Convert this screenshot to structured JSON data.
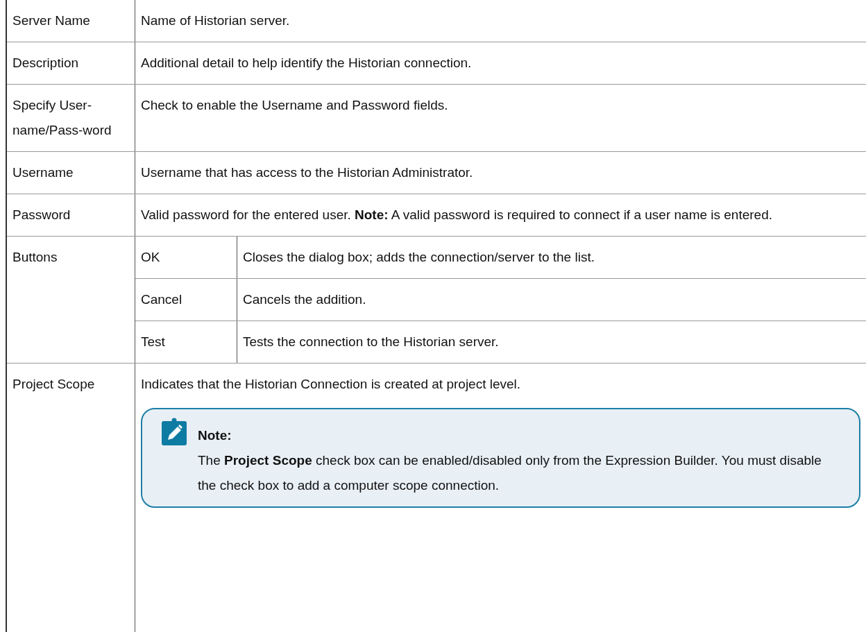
{
  "rows": [
    {
      "kind": "text",
      "label": "Server Name",
      "description": "Name of Historian server."
    },
    {
      "kind": "text",
      "label": "Description",
      "description": "Additional detail to help identify the Historian connection."
    },
    {
      "kind": "text",
      "label": "Specify User-name/Pass-word",
      "description": "Check to enable the Username and Password fields."
    },
    {
      "kind": "text",
      "label": "Username",
      "description": "Username that has access to the Historian Administrator."
    },
    {
      "kind": "text",
      "label": "Password",
      "description": "Valid password for the entered user. **Note:** A valid password is required to connect if a user name is entered."
    },
    {
      "kind": "buttons",
      "label": "Buttons",
      "items": [
        {
          "name": "OK",
          "description": "Closes the dialog box; adds the connection/server to the list."
        },
        {
          "name": "Cancel",
          "description": "Cancels the addition."
        },
        {
          "name": "Test",
          "description": "Tests the connection to the Historian server."
        }
      ]
    },
    {
      "kind": "note",
      "label": "Project Scope",
      "description": "Indicates that the Historian Connection is created at project level.",
      "note": {
        "title": "Note:",
        "text": "The **Project Scope** check box can be enabled/disabled only from the Expression Builder. You must disable the check box to add a computer scope connection."
      }
    }
  ]
}
